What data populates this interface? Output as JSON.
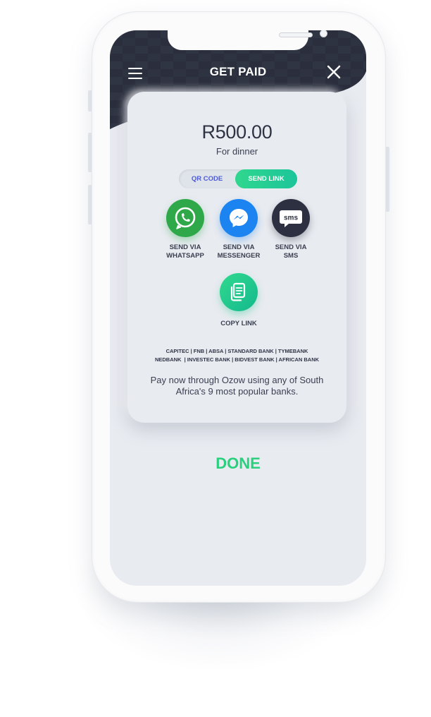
{
  "header": {
    "title": "GET PAID",
    "menu_icon": "hamburger-menu-icon",
    "close_icon": "close-icon",
    "color": "#2b2f3d"
  },
  "payment": {
    "amount": "R500.00",
    "note": "For dinner"
  },
  "toggle": {
    "options": [
      "QR CODE",
      "SEND LINK"
    ],
    "selected": "SEND LINK"
  },
  "share_options": [
    {
      "line1": "SEND VIA",
      "line2": "WHATSAPP",
      "icon": "whatsapp-icon",
      "color": "#2fa84a"
    },
    {
      "line1": "SEND VIA",
      "line2": "MESSENGER",
      "icon": "messenger-icon",
      "color": "#1b84f0"
    },
    {
      "line1": "SEND VIA",
      "line2": "SMS",
      "icon": "sms-icon",
      "color": "#2c3040"
    },
    {
      "line1": "COPY LINK",
      "line2": "",
      "icon": "copy-link-icon",
      "color": "#22c98a"
    }
  ],
  "banks": {
    "line1": "CAPITEC | FNB | ABSA | STANDARD BANK | TYMEBANK",
    "line2": "NEDBANK  | INVESTEC BANK | BIDVEST BANK | AFRICAN BANK"
  },
  "description": "Pay now through Ozow using any of South Africa's 9 most popular banks.",
  "done_label": "DONE",
  "accent_color": "#2ad07e"
}
